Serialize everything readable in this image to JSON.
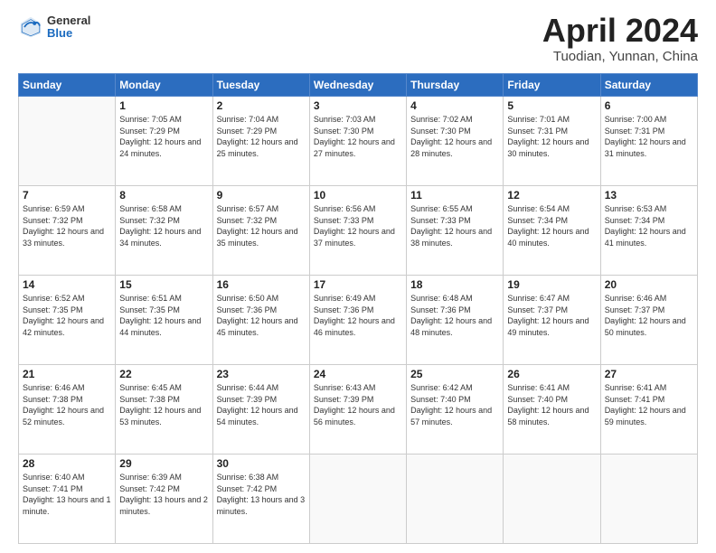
{
  "header": {
    "logo_general": "General",
    "logo_blue": "Blue",
    "title": "April 2024",
    "location": "Tuodian, Yunnan, China"
  },
  "days_of_week": [
    "Sunday",
    "Monday",
    "Tuesday",
    "Wednesday",
    "Thursday",
    "Friday",
    "Saturday"
  ],
  "weeks": [
    [
      {
        "day": "",
        "info": ""
      },
      {
        "day": "1",
        "info": "Sunrise: 7:05 AM\nSunset: 7:29 PM\nDaylight: 12 hours\nand 24 minutes."
      },
      {
        "day": "2",
        "info": "Sunrise: 7:04 AM\nSunset: 7:29 PM\nDaylight: 12 hours\nand 25 minutes."
      },
      {
        "day": "3",
        "info": "Sunrise: 7:03 AM\nSunset: 7:30 PM\nDaylight: 12 hours\nand 27 minutes."
      },
      {
        "day": "4",
        "info": "Sunrise: 7:02 AM\nSunset: 7:30 PM\nDaylight: 12 hours\nand 28 minutes."
      },
      {
        "day": "5",
        "info": "Sunrise: 7:01 AM\nSunset: 7:31 PM\nDaylight: 12 hours\nand 30 minutes."
      },
      {
        "day": "6",
        "info": "Sunrise: 7:00 AM\nSunset: 7:31 PM\nDaylight: 12 hours\nand 31 minutes."
      }
    ],
    [
      {
        "day": "7",
        "info": "Sunrise: 6:59 AM\nSunset: 7:32 PM\nDaylight: 12 hours\nand 33 minutes."
      },
      {
        "day": "8",
        "info": "Sunrise: 6:58 AM\nSunset: 7:32 PM\nDaylight: 12 hours\nand 34 minutes."
      },
      {
        "day": "9",
        "info": "Sunrise: 6:57 AM\nSunset: 7:32 PM\nDaylight: 12 hours\nand 35 minutes."
      },
      {
        "day": "10",
        "info": "Sunrise: 6:56 AM\nSunset: 7:33 PM\nDaylight: 12 hours\nand 37 minutes."
      },
      {
        "day": "11",
        "info": "Sunrise: 6:55 AM\nSunset: 7:33 PM\nDaylight: 12 hours\nand 38 minutes."
      },
      {
        "day": "12",
        "info": "Sunrise: 6:54 AM\nSunset: 7:34 PM\nDaylight: 12 hours\nand 40 minutes."
      },
      {
        "day": "13",
        "info": "Sunrise: 6:53 AM\nSunset: 7:34 PM\nDaylight: 12 hours\nand 41 minutes."
      }
    ],
    [
      {
        "day": "14",
        "info": "Sunrise: 6:52 AM\nSunset: 7:35 PM\nDaylight: 12 hours\nand 42 minutes."
      },
      {
        "day": "15",
        "info": "Sunrise: 6:51 AM\nSunset: 7:35 PM\nDaylight: 12 hours\nand 44 minutes."
      },
      {
        "day": "16",
        "info": "Sunrise: 6:50 AM\nSunset: 7:36 PM\nDaylight: 12 hours\nand 45 minutes."
      },
      {
        "day": "17",
        "info": "Sunrise: 6:49 AM\nSunset: 7:36 PM\nDaylight: 12 hours\nand 46 minutes."
      },
      {
        "day": "18",
        "info": "Sunrise: 6:48 AM\nSunset: 7:36 PM\nDaylight: 12 hours\nand 48 minutes."
      },
      {
        "day": "19",
        "info": "Sunrise: 6:47 AM\nSunset: 7:37 PM\nDaylight: 12 hours\nand 49 minutes."
      },
      {
        "day": "20",
        "info": "Sunrise: 6:46 AM\nSunset: 7:37 PM\nDaylight: 12 hours\nand 50 minutes."
      }
    ],
    [
      {
        "day": "21",
        "info": "Sunrise: 6:46 AM\nSunset: 7:38 PM\nDaylight: 12 hours\nand 52 minutes."
      },
      {
        "day": "22",
        "info": "Sunrise: 6:45 AM\nSunset: 7:38 PM\nDaylight: 12 hours\nand 53 minutes."
      },
      {
        "day": "23",
        "info": "Sunrise: 6:44 AM\nSunset: 7:39 PM\nDaylight: 12 hours\nand 54 minutes."
      },
      {
        "day": "24",
        "info": "Sunrise: 6:43 AM\nSunset: 7:39 PM\nDaylight: 12 hours\nand 56 minutes."
      },
      {
        "day": "25",
        "info": "Sunrise: 6:42 AM\nSunset: 7:40 PM\nDaylight: 12 hours\nand 57 minutes."
      },
      {
        "day": "26",
        "info": "Sunrise: 6:41 AM\nSunset: 7:40 PM\nDaylight: 12 hours\nand 58 minutes."
      },
      {
        "day": "27",
        "info": "Sunrise: 6:41 AM\nSunset: 7:41 PM\nDaylight: 12 hours\nand 59 minutes."
      }
    ],
    [
      {
        "day": "28",
        "info": "Sunrise: 6:40 AM\nSunset: 7:41 PM\nDaylight: 13 hours\nand 1 minute."
      },
      {
        "day": "29",
        "info": "Sunrise: 6:39 AM\nSunset: 7:42 PM\nDaylight: 13 hours\nand 2 minutes."
      },
      {
        "day": "30",
        "info": "Sunrise: 6:38 AM\nSunset: 7:42 PM\nDaylight: 13 hours\nand 3 minutes."
      },
      {
        "day": "",
        "info": ""
      },
      {
        "day": "",
        "info": ""
      },
      {
        "day": "",
        "info": ""
      },
      {
        "day": "",
        "info": ""
      }
    ]
  ]
}
